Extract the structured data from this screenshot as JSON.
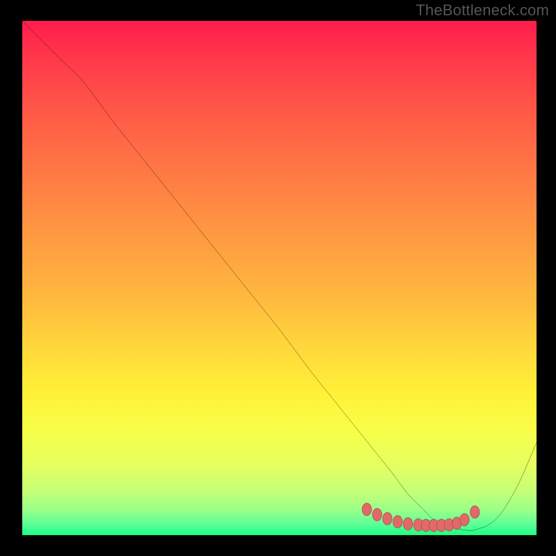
{
  "watermark": "TheBottleneck.com",
  "colors": {
    "curve": "#000000",
    "dots": "#e06a6a",
    "dots_stroke": "#b84c4c",
    "frame_bg": "#000000"
  },
  "chart_data": {
    "type": "line",
    "title": "",
    "xlabel": "",
    "ylabel": "",
    "xlim": [
      0,
      100
    ],
    "ylim": [
      0,
      100
    ],
    "series": [
      {
        "name": "curve",
        "x": [
          0,
          4,
          8,
          12,
          18,
          26,
          34,
          42,
          50,
          56,
          60,
          64,
          68,
          72,
          75,
          78,
          80,
          82,
          84,
          86,
          88,
          92,
          96,
          100
        ],
        "y": [
          100,
          96,
          92,
          88,
          80,
          70,
          60,
          50,
          40,
          32,
          27,
          22,
          17,
          12,
          8,
          5,
          3,
          2,
          1.5,
          1,
          1,
          3,
          9,
          18
        ]
      }
    ],
    "dots": {
      "name": "highlight",
      "x": [
        67,
        69,
        71,
        73,
        75,
        77,
        78.5,
        80,
        81.5,
        83,
        84.5,
        86,
        88
      ],
      "y": [
        5.0,
        4.0,
        3.2,
        2.6,
        2.2,
        2.0,
        1.9,
        1.9,
        1.9,
        2.0,
        2.3,
        3.0,
        4.5
      ]
    }
  }
}
